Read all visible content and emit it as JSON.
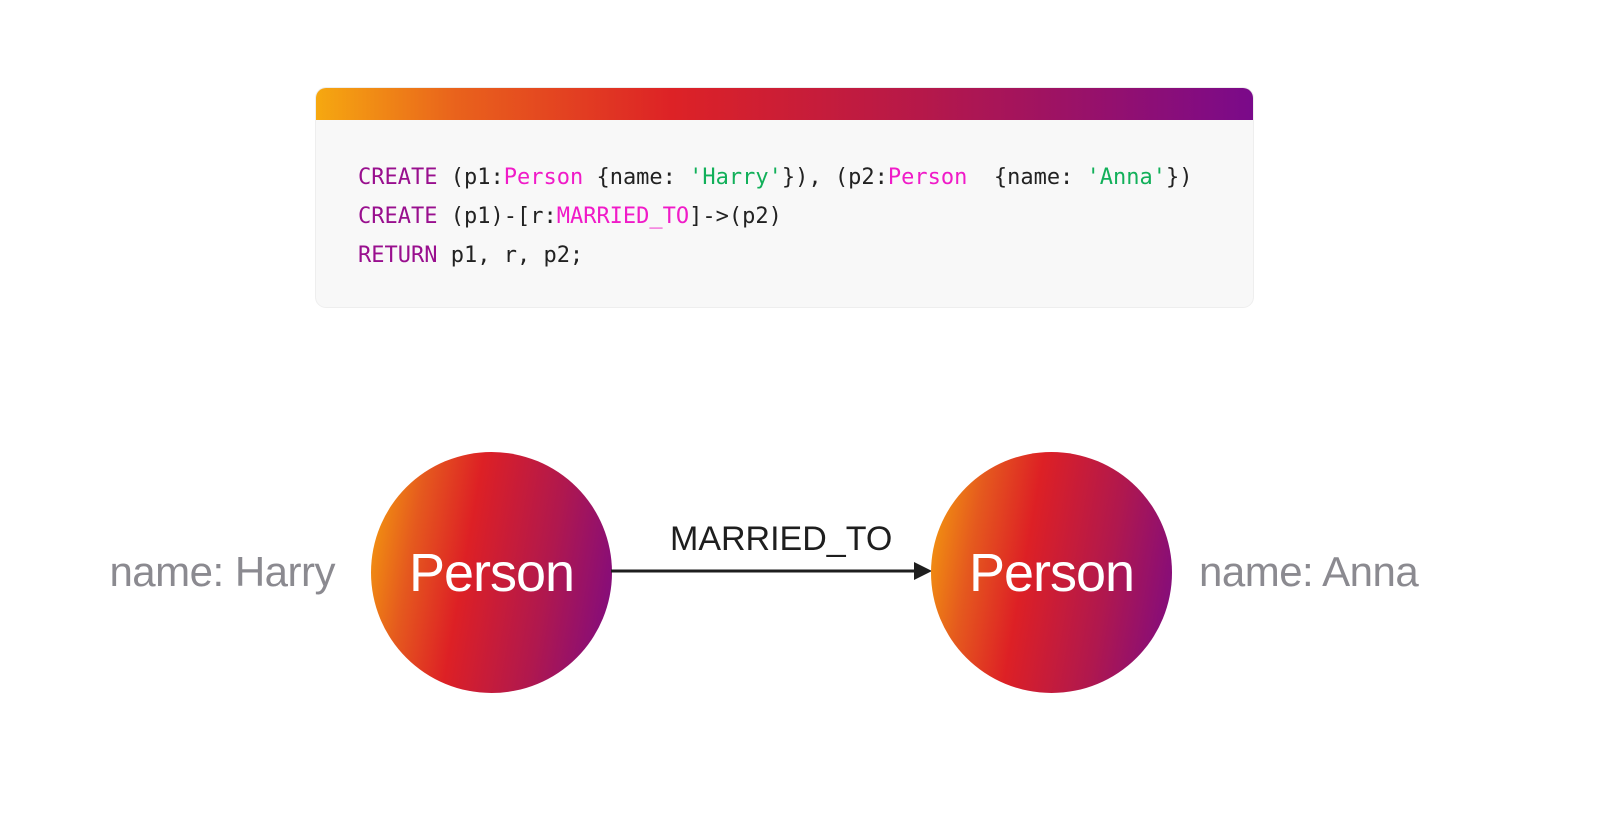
{
  "code": {
    "lines": [
      [
        {
          "t": "CREATE",
          "c": "kw"
        },
        {
          "t": " (p1:",
          "c": "plain"
        },
        {
          "t": "Person",
          "c": "lbl"
        },
        {
          "t": " {name: ",
          "c": "plain"
        },
        {
          "t": "'Harry'",
          "c": "str"
        },
        {
          "t": "}), (p2:",
          "c": "plain"
        },
        {
          "t": "Person",
          "c": "lbl"
        },
        {
          "t": "  {name: ",
          "c": "plain"
        },
        {
          "t": "'Anna'",
          "c": "str"
        },
        {
          "t": "})",
          "c": "plain"
        }
      ],
      [
        {
          "t": "CREATE",
          "c": "kw"
        },
        {
          "t": " (p1)-[r:",
          "c": "plain"
        },
        {
          "t": "MARRIED_TO",
          "c": "lbl"
        },
        {
          "t": "]->(p2)",
          "c": "plain"
        }
      ],
      [
        {
          "t": "RETURN",
          "c": "kw"
        },
        {
          "t": " p1, r, p2;",
          "c": "plain"
        }
      ]
    ],
    "colors": {
      "keyword": "#990f8e",
      "label": "#f01bc8",
      "string": "#12b05a",
      "header_gradient": [
        "#f6a810",
        "#dd2226",
        "#7a0a8a"
      ]
    }
  },
  "graph": {
    "nodes": [
      {
        "label": "Person",
        "property": "name: Harry"
      },
      {
        "label": "Person",
        "property": "name: Anna"
      }
    ],
    "relationship": {
      "type": "MARRIED_TO",
      "direction": "left-to-right"
    }
  }
}
